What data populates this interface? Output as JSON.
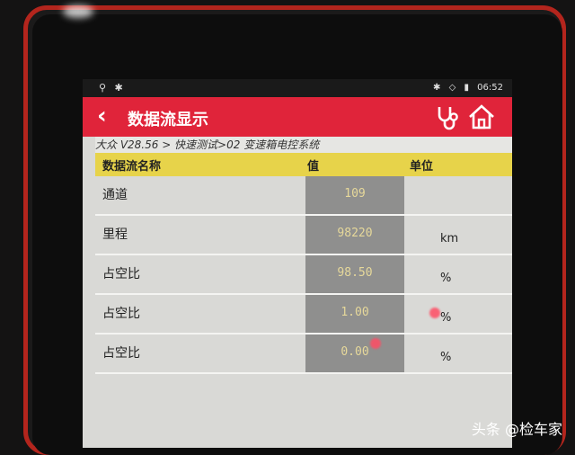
{
  "status_bar": {
    "time": "06:52"
  },
  "header": {
    "title": "数据流显示"
  },
  "breadcrumb": "大众 V28.56 > 快速测试>02 变速箱电控系统",
  "table": {
    "columns": [
      "数据流名称",
      "值",
      "单位"
    ],
    "rows": [
      {
        "name": "通道",
        "value": "109",
        "unit": ""
      },
      {
        "name": "里程",
        "value": "98220",
        "unit": "km"
      },
      {
        "name": "占空比",
        "value": "98.50",
        "unit": "%"
      },
      {
        "name": "占空比",
        "value": "1.00",
        "unit": "%"
      },
      {
        "name": "占空比",
        "value": "0.00",
        "unit": "%"
      }
    ]
  },
  "watermark": "头条 @检车家",
  "colors": {
    "header": "#e0243a",
    "table_header": "#e7d34a",
    "value_cell": "#8f8f8e",
    "bezel": "#b3251d"
  },
  "icons": [
    "back-arrow-icon",
    "stethoscope-icon",
    "home-icon",
    "bluetooth-icon",
    "wifi-icon",
    "battery-icon"
  ]
}
